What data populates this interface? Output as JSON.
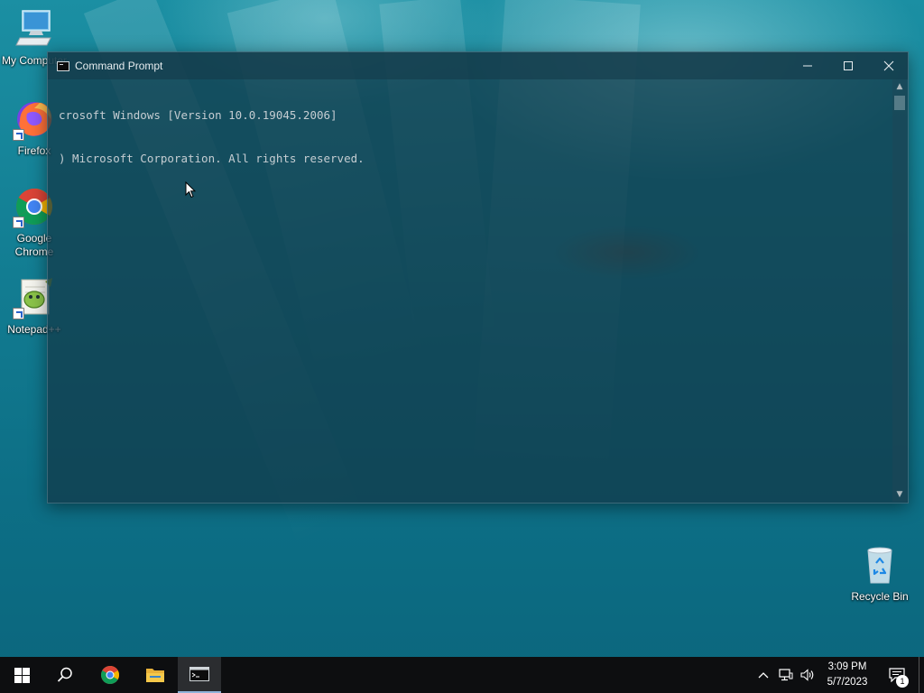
{
  "desktop": {
    "icons": [
      {
        "label": "My Computer",
        "icon": "computer-icon"
      },
      {
        "label": "Firefox",
        "icon": "firefox-icon"
      },
      {
        "label": "Google Chrome",
        "icon": "chrome-icon"
      },
      {
        "label": "Notepad++",
        "icon": "notepadpp-icon"
      },
      {
        "label": "Recycle Bin",
        "icon": "recycle-bin-icon"
      }
    ]
  },
  "window": {
    "title": "Command Prompt",
    "lines": [
      "crosoft Windows [Version 10.0.19045.2006]",
      ") Microsoft Corporation. All rights reserved."
    ]
  },
  "taskbar": {
    "clock_time": "3:09 PM",
    "clock_date": "5/7/2023",
    "notification_count": "1"
  },
  "colors": {
    "taskbar": "#0d0e10",
    "desktop_accent": "#137f94",
    "terminal_text": "#c5cdd2"
  }
}
